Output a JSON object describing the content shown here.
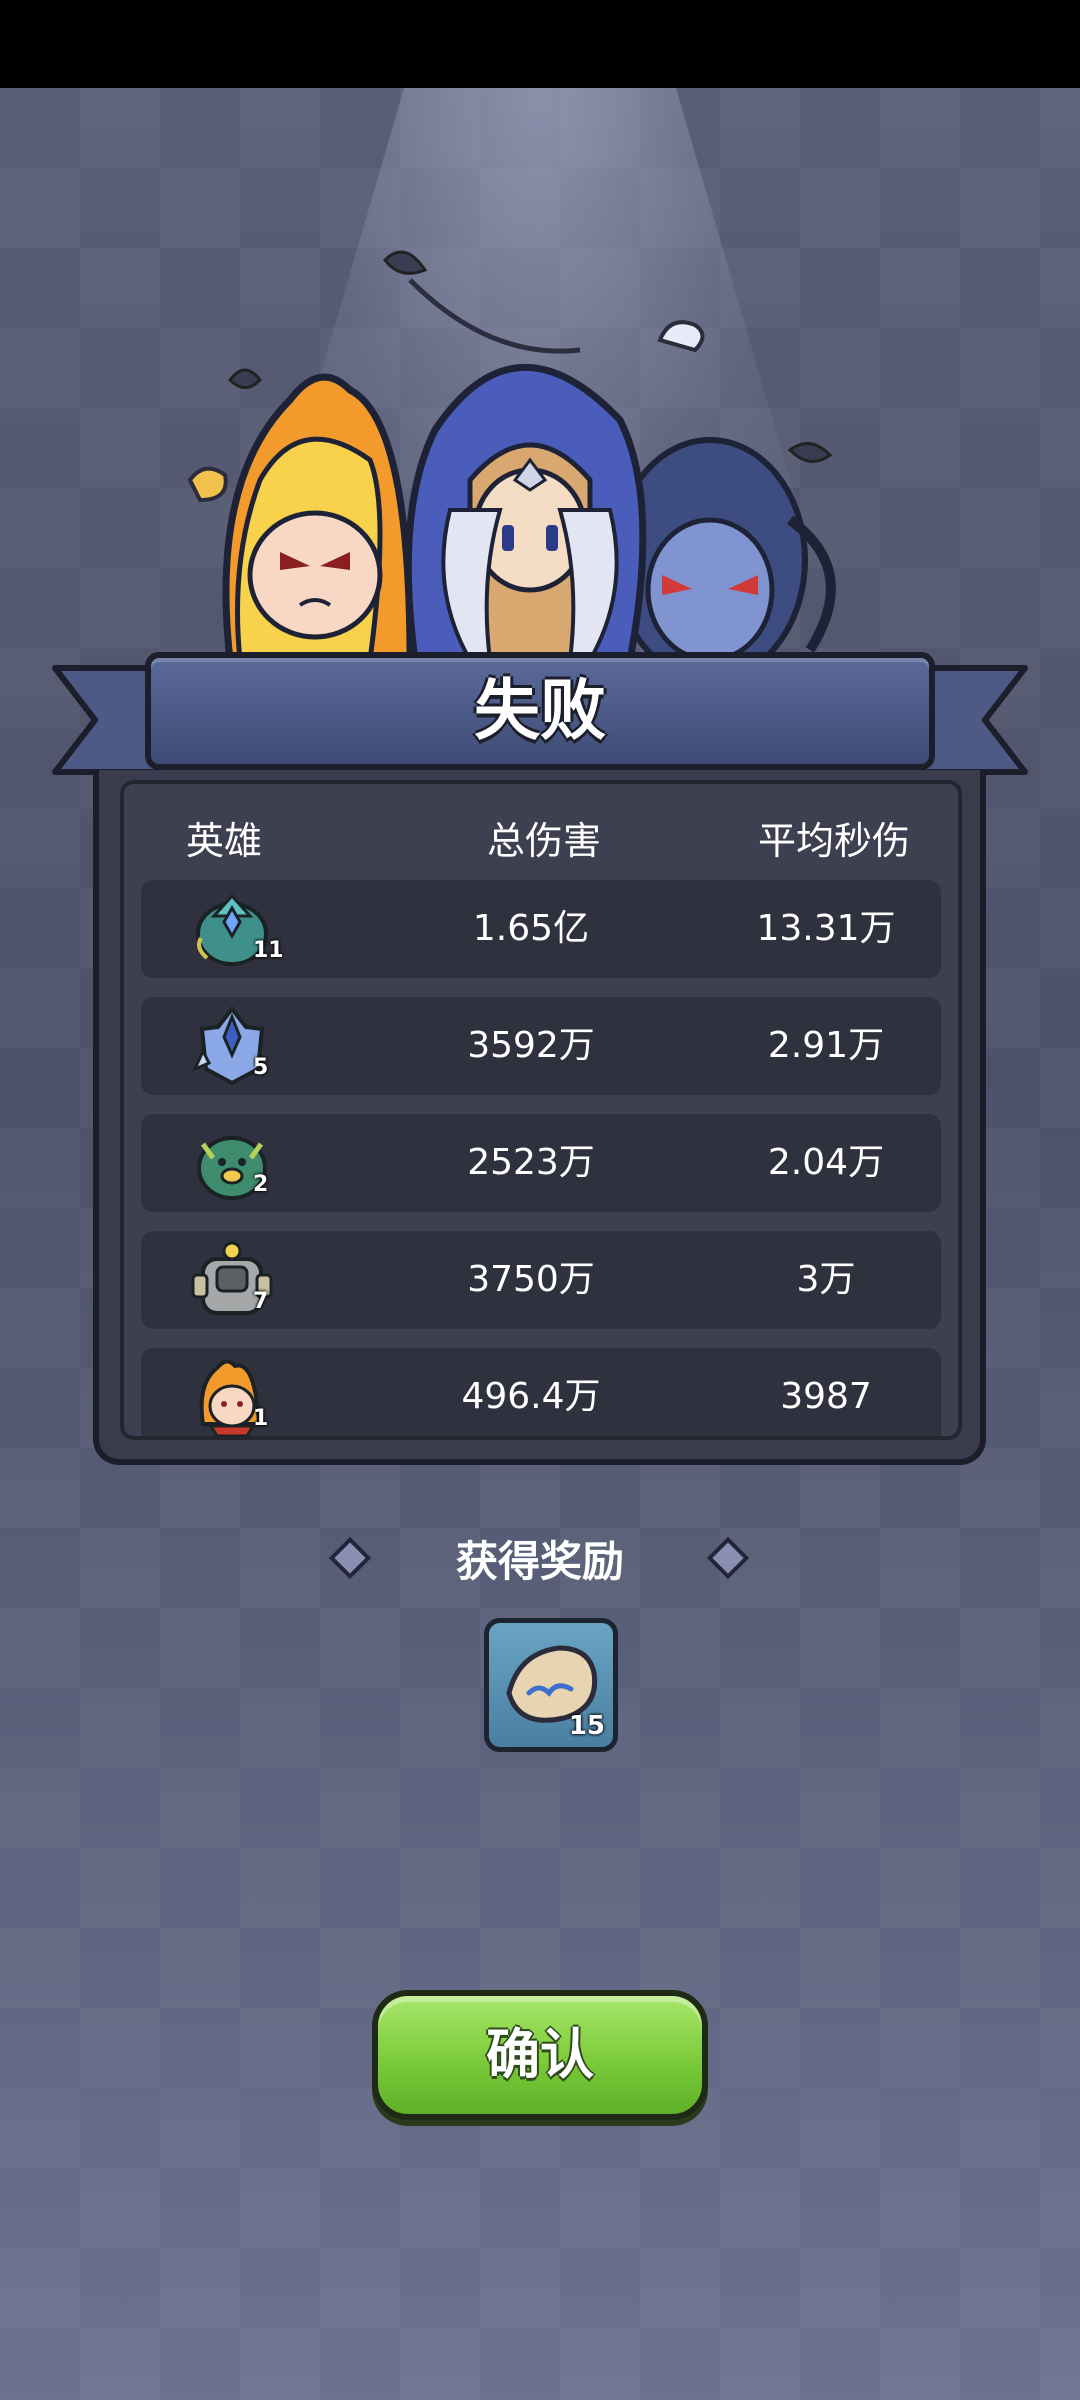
{
  "result": {
    "title": "失败"
  },
  "table": {
    "headers": {
      "hero": "英雄",
      "total": "总伤害",
      "dps": "平均秒伤"
    },
    "rows": [
      {
        "icon": "teal-crystal-hero-icon",
        "level": "11",
        "total": "1.65亿",
        "dps": "13.31万"
      },
      {
        "icon": "ice-knight-hero-icon",
        "level": "5",
        "total": "3592万",
        "dps": "2.91万"
      },
      {
        "icon": "green-dragon-hero-icon",
        "level": "2",
        "total": "2523万",
        "dps": "2.04万"
      },
      {
        "icon": "stone-golem-hero-icon",
        "level": "7",
        "total": "3750万",
        "dps": "3万"
      },
      {
        "icon": "fire-hero-icon",
        "level": "1",
        "total": "496.4万",
        "dps": "3987"
      }
    ]
  },
  "reward": {
    "title": "获得奖励",
    "item_icon": "rune-stone-icon",
    "count": "15"
  },
  "confirm": {
    "label": "确认"
  },
  "colors": {
    "banner": "#4a5784",
    "panel": "#3a3b4d",
    "confirm": "#7ccb3a",
    "background": "#565b73"
  }
}
